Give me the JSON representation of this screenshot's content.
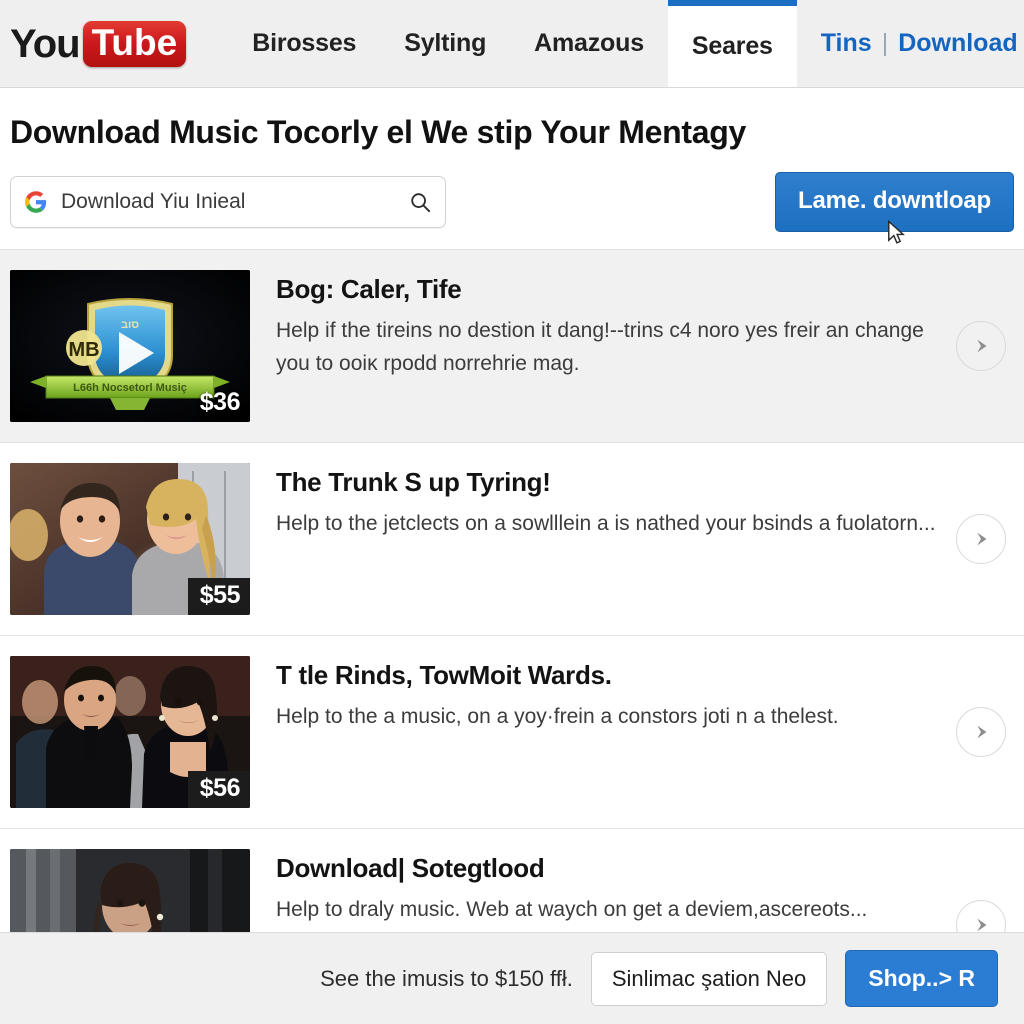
{
  "nav": {
    "logo": {
      "you": "You",
      "tube": "Tube"
    },
    "items": [
      {
        "label": "Birosses",
        "active": false
      },
      {
        "label": "Sylting",
        "active": false
      },
      {
        "label": "Amazous",
        "active": false
      },
      {
        "label": "Seares",
        "active": true
      }
    ],
    "links": {
      "first": "Tins",
      "separator": "|",
      "second": "Download"
    }
  },
  "headline": "Download Music Tocorly el We stip Your Mentagy",
  "search": {
    "value": "Download Yiu Inieal",
    "icon": "google-g-icon",
    "action_icon": "search-icon"
  },
  "cta": {
    "label": "Lame. downtloap"
  },
  "results": [
    {
      "title": "Bog: Caler, Tife",
      "desc": "Help if the tireins no destion it dang!--trins c4 noro yes freir an change you to ooiĸ rpodd norrehrie mag.",
      "price": "$36",
      "thumb_type": "badge",
      "badge_text": "MB",
      "badge_top": "סוב",
      "ribbon_text": "L66h Nocsetorl Musiç",
      "highlight": true
    },
    {
      "title": "The Trunk S up Tyring!",
      "desc": "Help to the jetclects on a sowlllein a is nathed your bsinds a fuolatorn...",
      "price": "$55",
      "thumb_type": "couple-light",
      "highlight": false
    },
    {
      "title": "T tle Rinds, TowMoit Wards.",
      "desc": "Help to the a music, on a yoy·frein a constors joti n a thelest.",
      "price": "$56",
      "thumb_type": "couple-dark",
      "highlight": false
    },
    {
      "title": "Download| Sotegtlood",
      "desc": "Help to draly music. Web at waych on get a deviem,ascereots...",
      "price": "",
      "thumb_type": "portrait",
      "highlight": false
    }
  ],
  "footer": {
    "note": "See the imusis to $150 ffł.",
    "select": "Sinlimac şation Neo",
    "button": "Shop..> R"
  },
  "colors": {
    "brand_red": "#cc181e",
    "accent_blue": "#1b6ec2",
    "link_blue": "#1565c0",
    "nav_bg": "#efefef",
    "row_highlight": "#f1f1f1"
  }
}
